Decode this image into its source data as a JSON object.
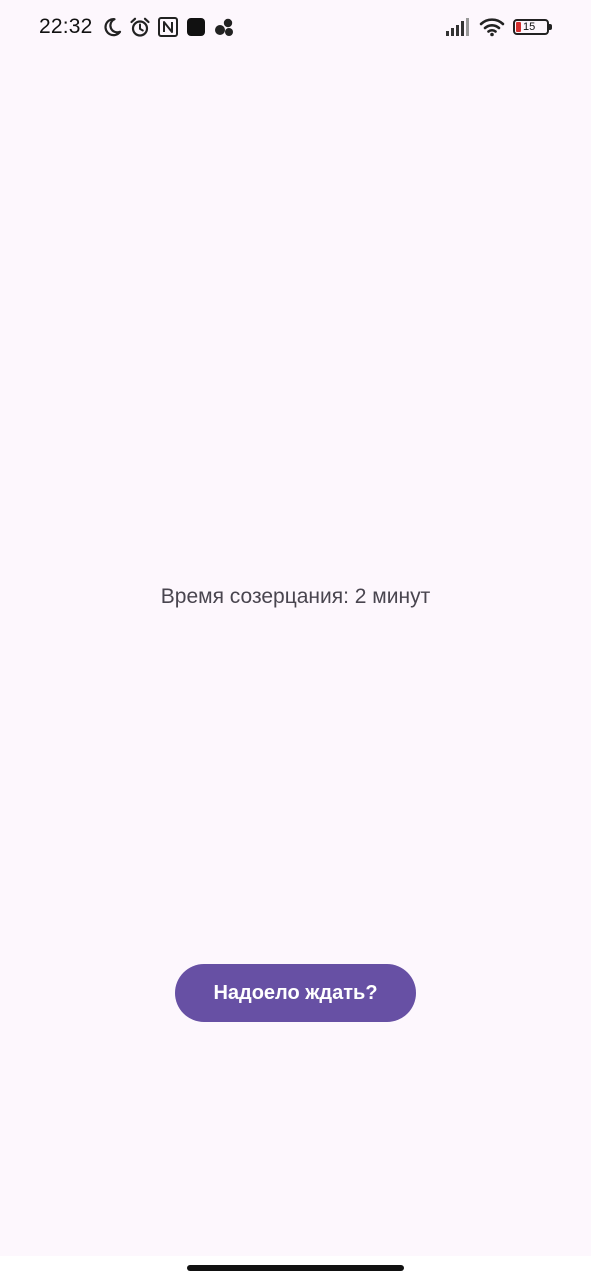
{
  "status_bar": {
    "time": "22:32",
    "left_icons": [
      "moon-icon",
      "alarm-icon",
      "nfc-icon",
      "app-square-icon",
      "app-dots-icon"
    ],
    "right_icons": [
      "signal-icon",
      "wifi-icon",
      "battery-icon"
    ],
    "battery_level": "15",
    "battery_color": "#d32f2f"
  },
  "main": {
    "contemplation_text": "Время созерцания: 2 минут",
    "button_label": "Надоело ждать?"
  },
  "colors": {
    "background": "#fdf7fd",
    "button": "#6750a4",
    "button_text": "#ffffff",
    "body_text": "#49454f"
  }
}
